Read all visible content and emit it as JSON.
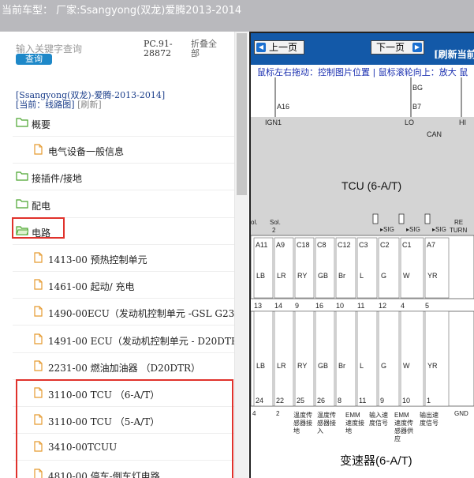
{
  "topbar": {
    "vehicle_label": "当前车型：",
    "vehicle_value": "厂家:Ssangyong(双龙)爱腾2013-2014"
  },
  "search": {
    "placeholder": "输入关键字查询",
    "button": "查询",
    "pc_code": "PC.91-28872",
    "collapse_all": "折叠全部"
  },
  "path": {
    "model": "[Ssangyong(双龙)-爱腾-2013-2014]",
    "current": "[当前：线路图]",
    "refresh": "[刷新]"
  },
  "tree": [
    {
      "type": "folder",
      "label": "概要"
    },
    {
      "type": "doc",
      "label": "电气设备一般信息"
    },
    {
      "type": "folder",
      "label": "接插件/接地"
    },
    {
      "type": "folder",
      "label": "配电"
    },
    {
      "type": "folder",
      "label": "电路",
      "open": true
    },
    {
      "type": "doc",
      "label": "1413-00 预热控制单元"
    },
    {
      "type": "doc",
      "label": "1461-00 起动/ 充电"
    },
    {
      "type": "doc",
      "label": "1490-00ECU（发动机控制单元 -GSL G23"
    },
    {
      "type": "doc",
      "label": "1491-00 ECU（发动机控制单元 - D20DTR"
    },
    {
      "type": "doc",
      "label": "2231-00 燃油加油器 （D20DTR）"
    },
    {
      "type": "doc",
      "label": "3110-00 TCU （6-A/T）"
    },
    {
      "type": "doc",
      "label": "3110-00 TCU （5-A/T）"
    },
    {
      "type": "doc",
      "label": "3410-00TCUU"
    },
    {
      "type": "doc",
      "label": "4810-00 停车-倒车灯电路"
    }
  ],
  "viewer": {
    "prev": "上一页",
    "next": "下一页",
    "refresh_current": "[刷新当前",
    "hint": "鼠标左右拖动：控制图片位置 | 鼠标滚轮向上：放大  鼠"
  },
  "diagram": {
    "top_pins": [
      "BG",
      "B7",
      "A16"
    ],
    "top_signals": [
      "IGN1",
      "LO",
      "HI",
      "CAN"
    ],
    "tcu_label": "TCU (6-A/T)",
    "sig_labels": [
      "SIG",
      "SIG",
      "SIG"
    ],
    "pins": [
      "A11",
      "A9",
      "C18",
      "C8",
      "C12",
      "C3",
      "C2",
      "C1",
      "A7"
    ],
    "wire_colors_top": [
      "LB",
      "LR",
      "RY",
      "GB",
      "Br",
      "L",
      "G",
      "W",
      "YR"
    ],
    "mid_nums": [
      "13",
      "14",
      "9",
      "16",
      "10",
      "11",
      "12",
      "4",
      "5"
    ],
    "wire_colors_bottom": [
      "LB",
      "LR",
      "RY",
      "GB",
      "Br",
      "L",
      "G",
      "W",
      "YR"
    ],
    "bot_nums": [
      "24",
      "22",
      "25",
      "26",
      "8",
      "11",
      "9",
      "10",
      "1"
    ],
    "bottom_labels": [
      "温度传感器接地",
      "温度传感器接入",
      "EMM速度接地",
      "输入速度信号",
      "EMM速度传感器供应",
      "输出速度信号"
    ],
    "gnd_label": "GND",
    "transmission": "变速器(6-A/T)",
    "left_labels": [
      "ol.",
      "Sol.",
      "2"
    ],
    "re_turn": [
      "RE",
      "TURN"
    ]
  }
}
